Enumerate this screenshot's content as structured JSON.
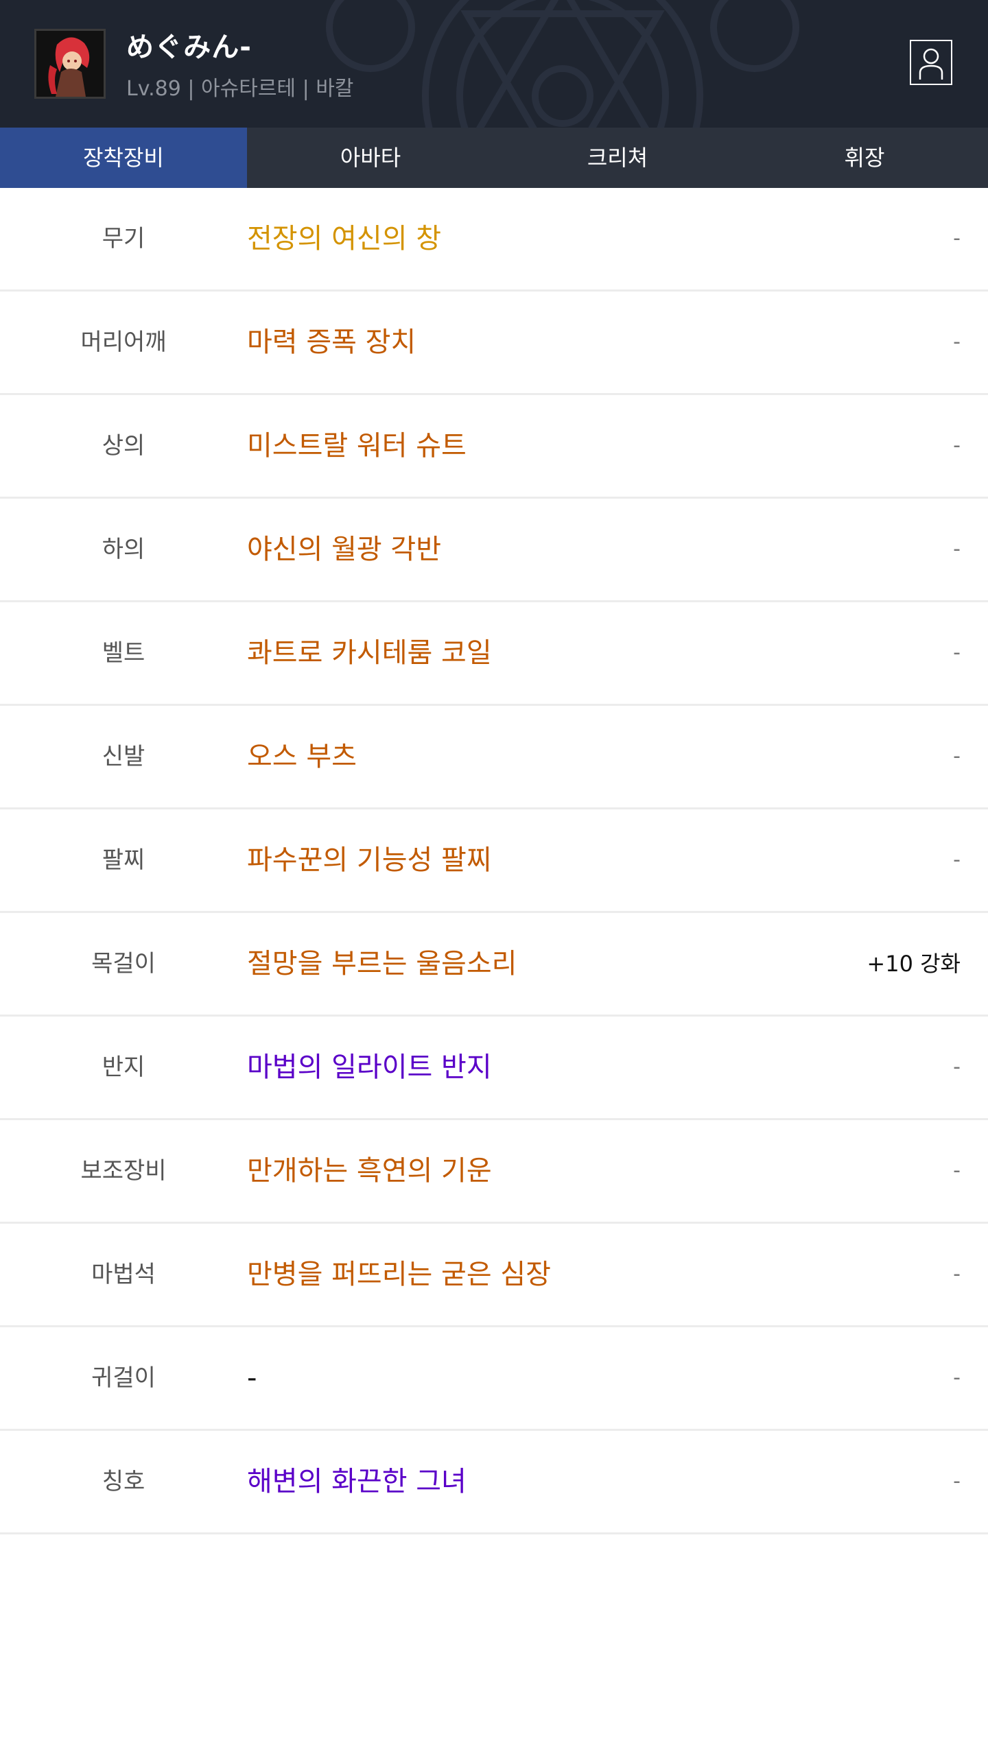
{
  "character": {
    "name": "めぐみん-",
    "info": "Lv.89 | 아슈타르테 | 바칼",
    "avatar_icon": "character-portrait",
    "profile_icon": "person-outline-icon"
  },
  "tabs": [
    {
      "label": "장착장비",
      "active": true
    },
    {
      "label": "아바타",
      "active": false
    },
    {
      "label": "크리쳐",
      "active": false
    },
    {
      "label": "휘장",
      "active": false
    }
  ],
  "colors": {
    "header_bg": "#1f2530",
    "tab_bg": "#2c323d",
    "tab_active": "#2f4d92",
    "legendary": "#c98a00",
    "epic": "#c25a00",
    "unique": "#5a00c8",
    "none": "#111111"
  },
  "equipment": [
    {
      "slot": "무기",
      "item": "전장의 여신의 창",
      "color": "#d49300",
      "enhance": "-"
    },
    {
      "slot": "머리어깨",
      "item": "마력 증폭 장치",
      "color": "#c25a00",
      "enhance": "-"
    },
    {
      "slot": "상의",
      "item": "미스트랄 워터 슈트",
      "color": "#c25a00",
      "enhance": "-"
    },
    {
      "slot": "하의",
      "item": "야신의 월광 각반",
      "color": "#c25a00",
      "enhance": "-"
    },
    {
      "slot": "벨트",
      "item": "콰트로 카시테룸 코일",
      "color": "#c25a00",
      "enhance": "-"
    },
    {
      "slot": "신발",
      "item": "오스 부츠",
      "color": "#c25a00",
      "enhance": "-"
    },
    {
      "slot": "팔찌",
      "item": "파수꾼의 기능성 팔찌",
      "color": "#c25a00",
      "enhance": "-"
    },
    {
      "slot": "목걸이",
      "item": "절망을 부르는 울음소리",
      "color": "#c25a00",
      "enhance": "+10 강화"
    },
    {
      "slot": "반지",
      "item": "마법의 일라이트 반지",
      "color": "#5a00c8",
      "enhance": "-"
    },
    {
      "slot": "보조장비",
      "item": "만개하는 흑연의 기운",
      "color": "#c25a00",
      "enhance": "-"
    },
    {
      "slot": "마법석",
      "item": "만병을 퍼뜨리는 굳은 심장",
      "color": "#c25a00",
      "enhance": "-"
    },
    {
      "slot": "귀걸이",
      "item": "-",
      "color": "#111111",
      "enhance": "-"
    },
    {
      "slot": "칭호",
      "item": "해변의 화끈한 그녀",
      "color": "#5a00c8",
      "enhance": "-"
    }
  ]
}
